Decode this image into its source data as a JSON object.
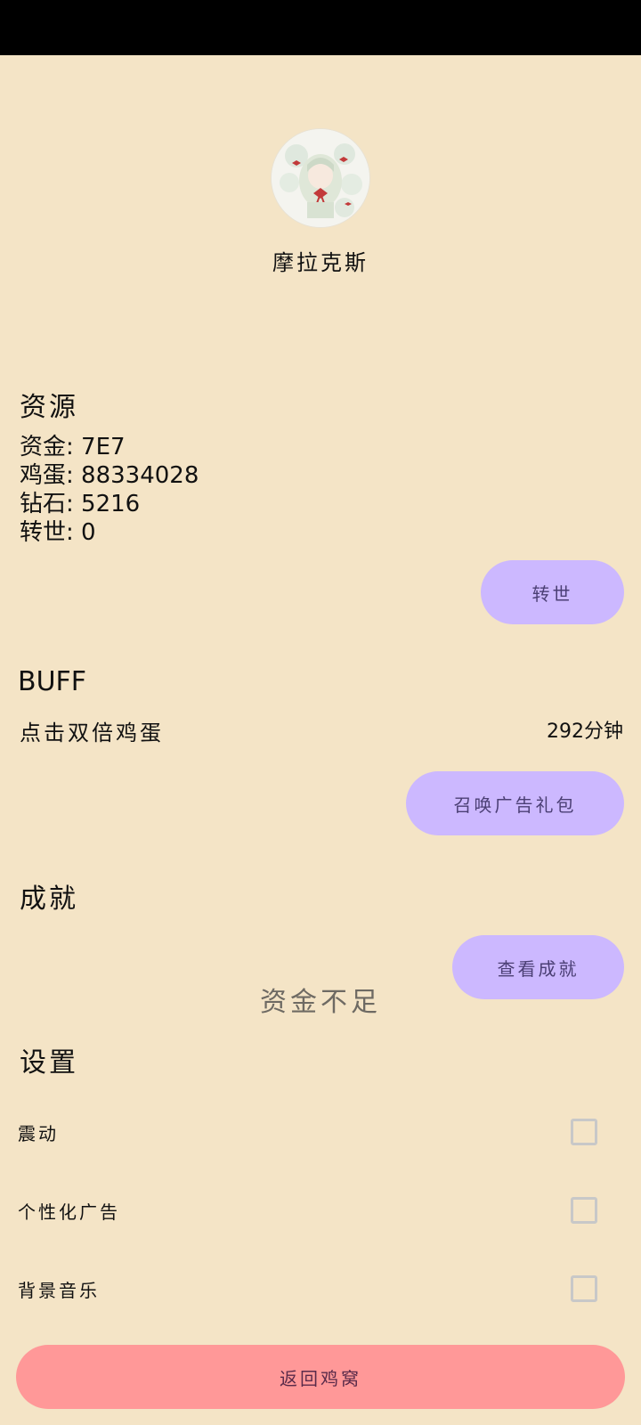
{
  "profile": {
    "username": "摩拉克斯",
    "avatar_icon": "anime-girl-avatar-icon"
  },
  "resources": {
    "title": "资源",
    "funds": "资金: 7E7",
    "eggs": "鸡蛋: 88334028",
    "diamonds": "钻石: 5216",
    "rebirths": "转世: 0",
    "rebirth_button": "转世"
  },
  "buff": {
    "title": "BUFF",
    "label": "点击双倍鸡蛋",
    "value": "292分钟",
    "summon_button": "召唤广告礼包"
  },
  "achievements": {
    "title": "成就",
    "view_button": "查看成就"
  },
  "toast": "资金不足",
  "settings": {
    "title": "设置",
    "items": [
      {
        "label": "震动",
        "checked": false
      },
      {
        "label": "个性化广告",
        "checked": false
      },
      {
        "label": "背景音乐",
        "checked": false
      }
    ]
  },
  "return_button": "返回鸡窝",
  "colors": {
    "background": "#f4e4c6",
    "button_purple": "#ccb8ff",
    "button_red": "#ff9898"
  }
}
